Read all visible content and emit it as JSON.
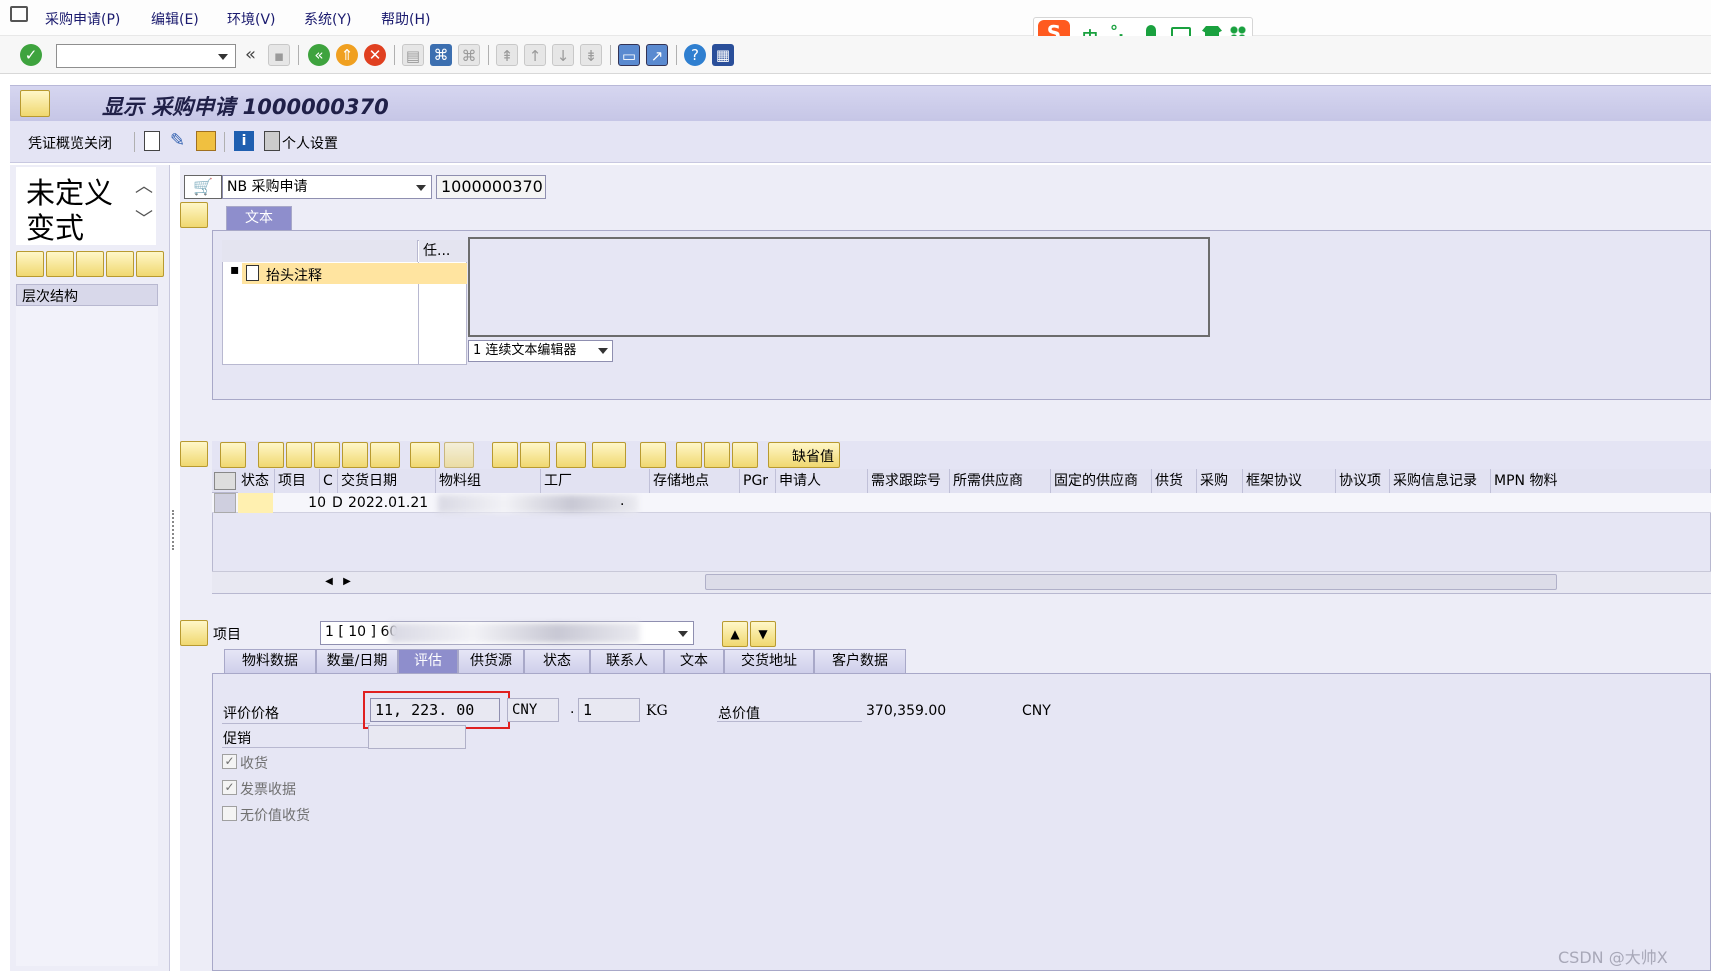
{
  "menubar": {
    "items": [
      "采购申请(P)",
      "编辑(E)",
      "环境(V)",
      "系统(Y)",
      "帮助(H)"
    ]
  },
  "toolbar": {
    "command_field": ""
  },
  "ime": {
    "mode": "中",
    "punct": "°,"
  },
  "title": {
    "text": "显示 采购申请 1000000370"
  },
  "apptoolbar": {
    "close_overview": "凭证概览关闭",
    "personal_settings": "个人设置"
  },
  "leftpanel": {
    "variant_line1": "未定义",
    "variant_line2": "变式",
    "hierarchy": "层次结构"
  },
  "header": {
    "doc_type": "NB 采购申请",
    "doc_number": "1000000370",
    "tab_text": "文本",
    "text_tree_col2": "任...",
    "text_item": "抬头注释",
    "editor_select": "1 连续文本编辑器"
  },
  "items_toolbar": {
    "default_values": "缺省值"
  },
  "items_grid": {
    "columns": [
      "状态",
      "项目",
      "C",
      "交货日期",
      "物料组",
      "工厂",
      "存储地点",
      "PGr",
      "申请人",
      "需求跟踪号",
      "所需供应商",
      "固定的供应商",
      "供货",
      "采购",
      "框架协议",
      "协议项",
      "采购信息记录",
      "MPN 物料"
    ],
    "rows": [
      {
        "item": "10",
        "cat": "D",
        "date": "2022.01.21",
        "extra": "."
      }
    ]
  },
  "detail": {
    "item_label": "项目",
    "item_select": "1 [ 10 ] 60",
    "tabs": [
      "物料数据",
      "数量/日期",
      "评估",
      "供货源",
      "状态",
      "联系人",
      "文本",
      "交货地址",
      "客户数据"
    ],
    "active_tab": "评估",
    "valuation_price_label": "评价价格",
    "valuation_price": "11, 223. 00",
    "currency": "CNY",
    "price_unit_dot": ".",
    "price_unit": "1",
    "unit": "KG",
    "total_label": "总价值",
    "total_value": "370,359.00",
    "total_currency": "CNY",
    "promotion_label": "促销",
    "checkboxes": [
      {
        "label": "收货",
        "checked": "✓"
      },
      {
        "label": "发票收据",
        "checked": "✓"
      },
      {
        "label": "无价值收货",
        "checked": ""
      }
    ]
  },
  "watermark": "CSDN @大帅X",
  "colors": {
    "highlight_box": "#e02020",
    "active_tab": "#8e8ecc",
    "panel_bg": "#ededf7"
  }
}
